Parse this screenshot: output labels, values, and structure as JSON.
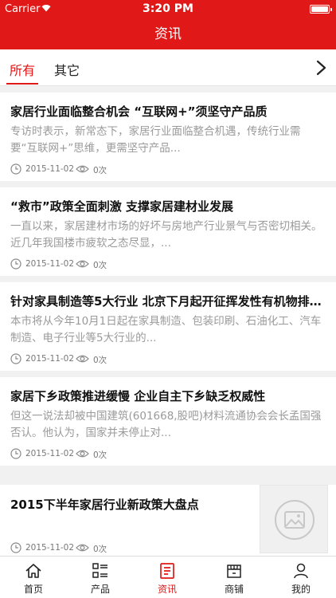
{
  "status_bar": {
    "carrier": "Carrier",
    "time": "3:20 PM"
  },
  "header": {
    "title": "资讯"
  },
  "tabs": [
    {
      "label": "所有",
      "active": true
    },
    {
      "label": "其它",
      "active": false
    }
  ],
  "articles": [
    {
      "title": "家居行业面临整合机会 “互联网+”须坚守产品质",
      "summary": "专访时表示，新常态下，家居行业面临整合机遇，传统行业需要“互联网+”思维，更需坚守产品...",
      "date": "2015-11-02",
      "views": "0次"
    },
    {
      "title": "“救市”政策全面刺激 支撑家居建材业发展",
      "summary": "一直以来，家居建材市场的好坏与房地产行业景气与否密切相关。近几年我国楼市疲软之态尽显，...",
      "date": "2015-11-02",
      "views": "0次"
    },
    {
      "title": "针对家具制造等5大行业 北京下月起开征挥发性有机物排...",
      "summary": "本市将从今年10月1日起在家具制造、包装印刷、石油化工、汽车制造、电子行业等5大行业的...",
      "date": "2015-11-02",
      "views": "0次"
    },
    {
      "title": "家居下乡政策推进缓慢 企业自主下乡缺乏权威性",
      "summary": "但这一说法却被中国建筑(601668,股吧)材料流通协会会长孟国强否认。他认为，国家并未停止对...",
      "date": "2015-11-02",
      "views": "0次"
    },
    {
      "title": "2015下半年家居行业新政策大盘点",
      "summary": "",
      "date": "2015-11-02",
      "views": "0次"
    }
  ],
  "bottom_nav": [
    {
      "label": "首页",
      "icon": "home-icon"
    },
    {
      "label": "产品",
      "icon": "grid-list-icon"
    },
    {
      "label": "资讯",
      "icon": "news-icon",
      "active": true
    },
    {
      "label": "商铺",
      "icon": "store-icon"
    },
    {
      "label": "我的",
      "icon": "user-icon"
    }
  ],
  "colors": {
    "accent": "#e01818",
    "background": "#f1f1f1"
  }
}
